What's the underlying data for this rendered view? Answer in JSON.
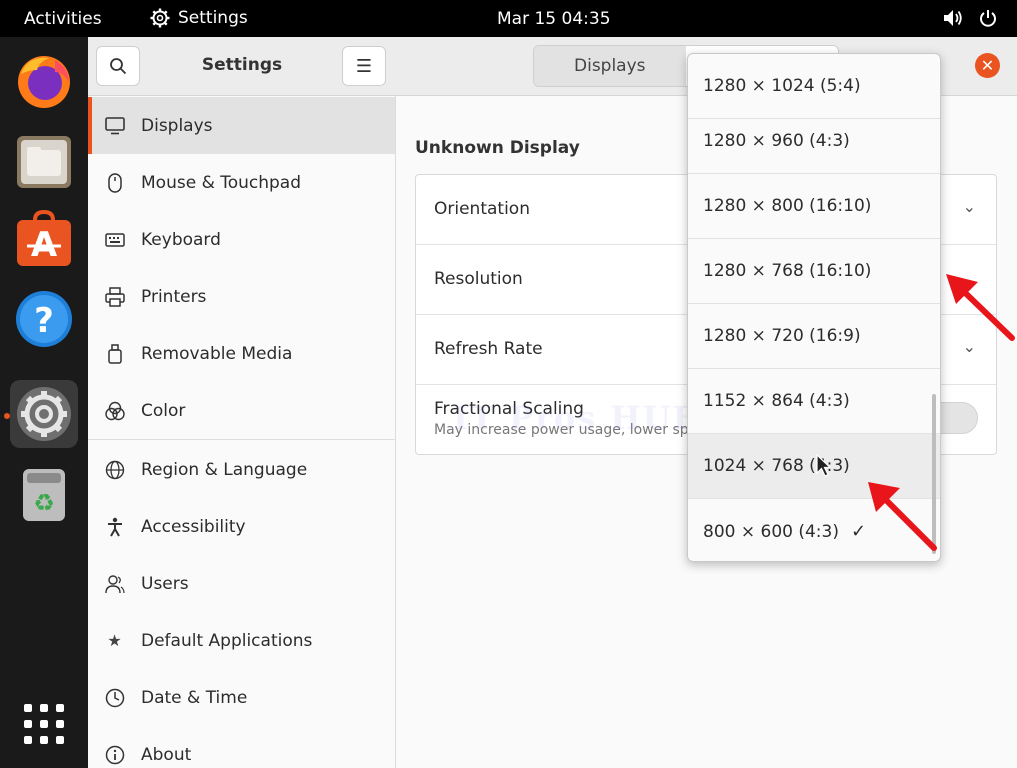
{
  "topbar": {
    "activities": "Activities",
    "app_name": "Settings",
    "clock": "Mar 15  04:35"
  },
  "dock": {
    "items": [
      {
        "name": "firefox-icon"
      },
      {
        "name": "files-icon"
      },
      {
        "name": "app-center-icon"
      },
      {
        "name": "help-icon"
      },
      {
        "name": "settings-icon"
      },
      {
        "name": "trash-icon"
      }
    ]
  },
  "sidebar": {
    "title": "Settings",
    "items": [
      {
        "label": "Displays",
        "icon": "display-icon"
      },
      {
        "label": "Mouse & Touchpad",
        "icon": "mouse-icon"
      },
      {
        "label": "Keyboard",
        "icon": "keyboard-icon"
      },
      {
        "label": "Printers",
        "icon": "printer-icon"
      },
      {
        "label": "Removable Media",
        "icon": "removable-media-icon"
      },
      {
        "label": "Color",
        "icon": "color-icon"
      },
      {
        "label": "Region & Language",
        "icon": "globe-icon"
      },
      {
        "label": "Accessibility",
        "icon": "accessibility-icon"
      },
      {
        "label": "Users",
        "icon": "users-icon"
      },
      {
        "label": "Default Applications",
        "icon": "star-icon"
      },
      {
        "label": "Date & Time",
        "icon": "clock-icon"
      },
      {
        "label": "About",
        "icon": "info-icon"
      }
    ]
  },
  "main": {
    "tab_displays": "Displays",
    "section_title": "Unknown Display",
    "rows": {
      "orientation": "Orientation",
      "resolution": "Resolution",
      "refresh_rate": "Refresh Rate",
      "fractional_scaling": "Fractional Scaling",
      "fractional_scaling_sub": "May increase power usage, lower sp"
    },
    "watermark": "IT Pros HUE"
  },
  "dropdown": {
    "options": [
      "1280 × 1024 (5:4)",
      "1280 × 960 (4:3)",
      "1280 × 800 (16:10)",
      "1280 × 768 (16:10)",
      "1280 × 720 (16:9)",
      "1152 × 864 (4:3)",
      "1024 × 768 (4:3)",
      "800 × 600 (4:3)"
    ],
    "selected": "800 × 600 (4:3)",
    "hovered": "1024 × 768 (4:3)"
  },
  "colors": {
    "accent": "#e95420",
    "annotation_arrow": "#e8151b"
  }
}
